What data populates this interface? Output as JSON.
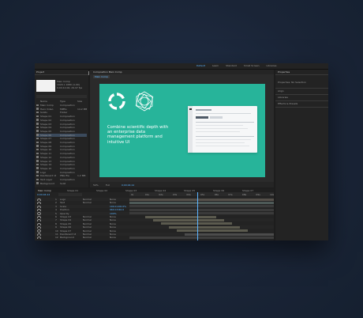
{
  "app": {
    "workspaces": [
      "Default",
      "Learn",
      "Standard",
      "Small Screen",
      "Libraries"
    ],
    "active_workspace": "Default"
  },
  "project": {
    "panel_title": "Project",
    "info_line1": "Main Comp",
    "info_line2": "1920 x 1080 (1.00)",
    "info_line3": "0;00;10;00, 29.97 fps",
    "columns": [
      "Name",
      "Type",
      "Size"
    ],
    "rows": [
      {
        "name": "Main Comp",
        "type": "Composition",
        "size": ""
      },
      {
        "name": "Hero Video",
        "type": "MPEG",
        "size": "14.2 MB"
      },
      {
        "name": "Solids",
        "type": "Folder",
        "size": ""
      },
      {
        "name": "Shape 01",
        "type": "Composition",
        "size": ""
      },
      {
        "name": "Shape 02",
        "type": "Composition",
        "size": ""
      },
      {
        "name": "Shape 03",
        "type": "Composition",
        "size": ""
      },
      {
        "name": "Shape 04",
        "type": "Composition",
        "size": ""
      },
      {
        "name": "Shape 05",
        "type": "Composition",
        "size": ""
      },
      {
        "name": "Shape 06",
        "type": "Composition",
        "size": ""
      },
      {
        "name": "Shape 07",
        "type": "Composition",
        "size": ""
      },
      {
        "name": "Shape 08",
        "type": "Composition",
        "size": ""
      },
      {
        "name": "Shape 09",
        "type": "Composition",
        "size": ""
      },
      {
        "name": "Shape 10",
        "type": "Composition",
        "size": ""
      },
      {
        "name": "Shape 11",
        "type": "Composition",
        "size": ""
      },
      {
        "name": "Shape 12",
        "type": "Composition",
        "size": ""
      },
      {
        "name": "Shape 13",
        "type": "Composition",
        "size": ""
      },
      {
        "name": "Shape 14",
        "type": "Composition",
        "size": ""
      },
      {
        "name": "Shape 15",
        "type": "Composition",
        "size": ""
      },
      {
        "name": "Logo",
        "type": "Composition",
        "size": ""
      },
      {
        "name": "Dashboard UI",
        "type": "PNG file",
        "size": "1.2 MB"
      },
      {
        "name": "Text Layer",
        "type": "Composition",
        "size": ""
      },
      {
        "name": "Background",
        "type": "Solid",
        "size": ""
      }
    ]
  },
  "viewer": {
    "tab_title": "Composition Main Comp",
    "breadcrumb": "Main Comp",
    "headline": "Combine scientific depth with an enterprise data management platform and intuitive UI",
    "zoom": "50%",
    "resolution": "Full",
    "timecode": "0;00;04;12"
  },
  "right_panel": {
    "title": "Properties",
    "sections": [
      "Properties: No Selection",
      "Align",
      "Libraries",
      "Effects & Presets"
    ]
  },
  "timeline": {
    "tabs": [
      "Main Comp",
      "Shape 01",
      "Shape 02",
      "Shape 03",
      "Shape 04",
      "Shape 05",
      "Shape 06",
      "Shape 07"
    ],
    "timecode": "0;00;04;12",
    "ruler": [
      "0s",
      "01s",
      "02s",
      "03s",
      "04s",
      "05s",
      "06s",
      "07s",
      "08s",
      "09s",
      "10s"
    ],
    "layers": [
      {
        "idx": "1",
        "name": "Logo",
        "mode": "Normal",
        "parent": "None"
      },
      {
        "idx": "2",
        "name": "Text",
        "mode": "Normal",
        "parent": "None"
      },
      {
        "idx": "3",
        "name": "Scale",
        "mode": "",
        "parent": "100.0,100.0%"
      },
      {
        "idx": "4",
        "name": "Position",
        "mode": "",
        "parent": "960.0,540.0"
      },
      {
        "idx": "5",
        "name": "Opacity",
        "mode": "",
        "parent": "100%"
      },
      {
        "idx": "6",
        "name": "Shape 03",
        "mode": "Normal",
        "parent": "None"
      },
      {
        "idx": "7",
        "name": "Shape 04",
        "mode": "Normal",
        "parent": "None"
      },
      {
        "idx": "8",
        "name": "Shape 05",
        "mode": "Normal",
        "parent": "None"
      },
      {
        "idx": "9",
        "name": "Shape 06",
        "mode": "Normal",
        "parent": "None"
      },
      {
        "idx": "10",
        "name": "Shape 07",
        "mode": "Normal",
        "parent": "None"
      },
      {
        "idx": "11",
        "name": "Dashboard UI",
        "mode": "Normal",
        "parent": "None"
      },
      {
        "idx": "12",
        "name": "Background",
        "mode": "Normal",
        "parent": "None"
      }
    ]
  },
  "colors": {
    "canvas": "#27b49a",
    "accent": "#5ab3ff",
    "panel": "#232323"
  }
}
